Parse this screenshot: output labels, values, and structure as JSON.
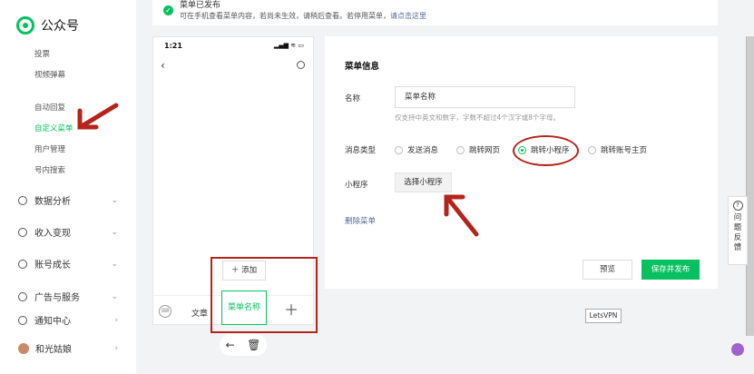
{
  "sidebar": {
    "brand": "公众号",
    "sub_items": [
      {
        "label": "投票",
        "active": false
      },
      {
        "label": "视频弹幕",
        "active": false
      },
      {
        "label": "自动回复",
        "active": false
      },
      {
        "label": "自定义菜单",
        "active": true
      },
      {
        "label": "用户管理",
        "active": false
      },
      {
        "label": "号内搜索",
        "active": false
      }
    ],
    "groups": [
      {
        "label": "数据分析",
        "icon": "chart-icon"
      },
      {
        "label": "收入变现",
        "icon": "income-icon"
      },
      {
        "label": "账号成长",
        "icon": "growth-icon"
      },
      {
        "label": "广告与服务",
        "icon": "ads-icon"
      },
      {
        "label": "通知中心",
        "icon": "bell-icon"
      },
      {
        "label": "和光姑娘",
        "icon": "avatar"
      }
    ]
  },
  "notice": {
    "title": "菜单已发布",
    "desc": "可在手机查看菜单内容，若尚未生效，请稍后查看。若停用菜单，",
    "link": "请点击这里"
  },
  "phone": {
    "time": "1:21",
    "status": "▂▄▆ ≋ ▭",
    "menu_article": "文章",
    "menu_active": "菜单名称",
    "add_label": "添加"
  },
  "panel": {
    "title": "菜单信息",
    "name_label": "名称",
    "name_value": "菜单名称",
    "name_hint": "仅支持中英文和数字，字数不超过4个汉字或8个字母。",
    "type_label": "消息类型",
    "types": [
      {
        "label": "发送消息",
        "selected": false
      },
      {
        "label": "跳转网页",
        "selected": false
      },
      {
        "label": "跳转小程序",
        "selected": true
      },
      {
        "label": "跳转账号主页",
        "selected": false
      }
    ],
    "miniapp_label": "小程序",
    "choose_button": "选择小程序",
    "delete_link": "删除菜单",
    "preview_button": "预览",
    "publish_button": "保存并发布"
  },
  "floating": {
    "letsvpn": "LetsVPN",
    "help_chars": [
      "问",
      "题",
      "反",
      "馈"
    ]
  },
  "colors": {
    "accent": "#07c160",
    "annotation_red": "#b3241c",
    "link": "#576b95"
  }
}
